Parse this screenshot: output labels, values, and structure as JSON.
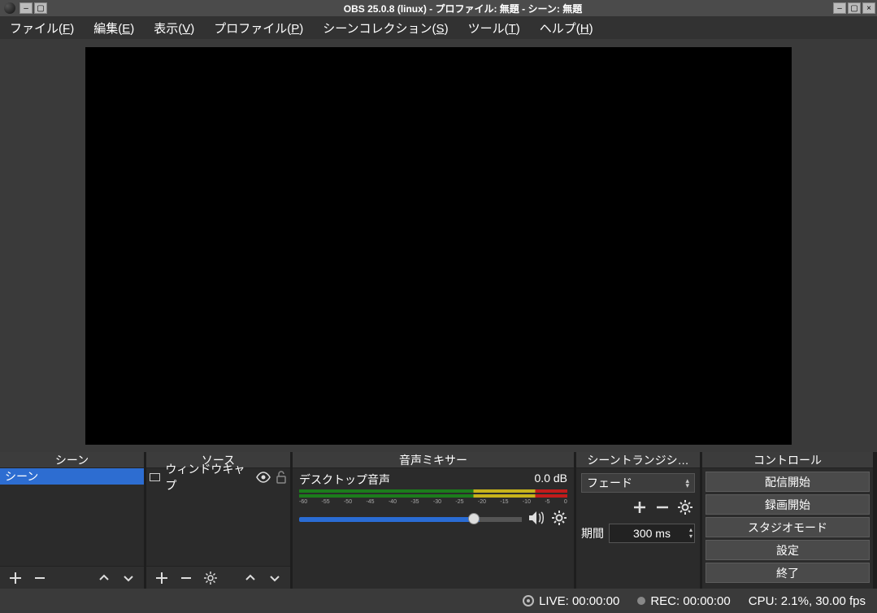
{
  "titlebar": {
    "title": "OBS 25.0.8 (linux) - プロファイル: 無題 - シーン: 無題"
  },
  "menu": {
    "file": "ファイル",
    "file_mn": "F",
    "edit": "編集",
    "edit_mn": "E",
    "view": "表示",
    "view_mn": "V",
    "profile": "プロファイル",
    "profile_mn": "P",
    "scene_collection": "シーンコレクション",
    "scene_collection_mn": "S",
    "tools": "ツール",
    "tools_mn": "T",
    "help": "ヘルプ",
    "help_mn": "H"
  },
  "panels": {
    "scenes_header": "シーン",
    "scene_name": "シーン",
    "sources_header": "ソース",
    "source_name": "ウィンドウキャプ",
    "mixer_header": "音声ミキサー",
    "mixer_channel": "デスクトップ音声",
    "mixer_level": "0.0 dB",
    "ticks": [
      "-60",
      "-55",
      "-50",
      "-45",
      "-40",
      "-35",
      "-30",
      "-25",
      "-20",
      "-15",
      "-10",
      "-5",
      "0"
    ],
    "transitions_header": "シーントランジシ…",
    "transition_type": "フェード",
    "duration_label": "期間",
    "duration_value": "300 ms",
    "controls_header": "コントロール",
    "controls": {
      "start_stream": "配信開始",
      "start_record": "録画開始",
      "studio_mode": "スタジオモード",
      "settings": "設定",
      "exit": "終了"
    }
  },
  "status": {
    "live": "LIVE: 00:00:00",
    "rec": "REC: 00:00:00",
    "cpu": "CPU: 2.1%, 30.00 fps"
  }
}
